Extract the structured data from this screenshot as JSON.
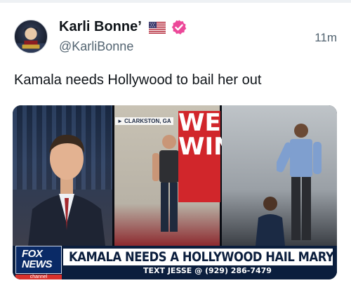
{
  "post": {
    "display_name": "Karli Bonne’",
    "handle": "@KarliBonne",
    "timestamp": "11m",
    "text": "Kamala needs Hollywood to bail her out",
    "avatar_icon": "profile-avatar",
    "flag_icon": "us-flag-icon",
    "verified_icon": "verified-badge-icon",
    "verified_color": "#ec4899"
  },
  "media": {
    "location_tag": "► CLARKSTON, GA",
    "sign_line1": "WE",
    "sign_line2": "WIN",
    "logo_line1": "FOX",
    "logo_line2": "NEWS",
    "logo_line3": "channel",
    "headline": "KAMALA NEEDS A HOLLYWOOD HAIL MARY",
    "ticker": "TEXT JESSE @ (929) 286-7479"
  },
  "colors": {
    "text_primary": "#0f1419",
    "text_secondary": "#536471",
    "brand_navy": "#0b1e3d",
    "sign_red": "#d1262b"
  }
}
